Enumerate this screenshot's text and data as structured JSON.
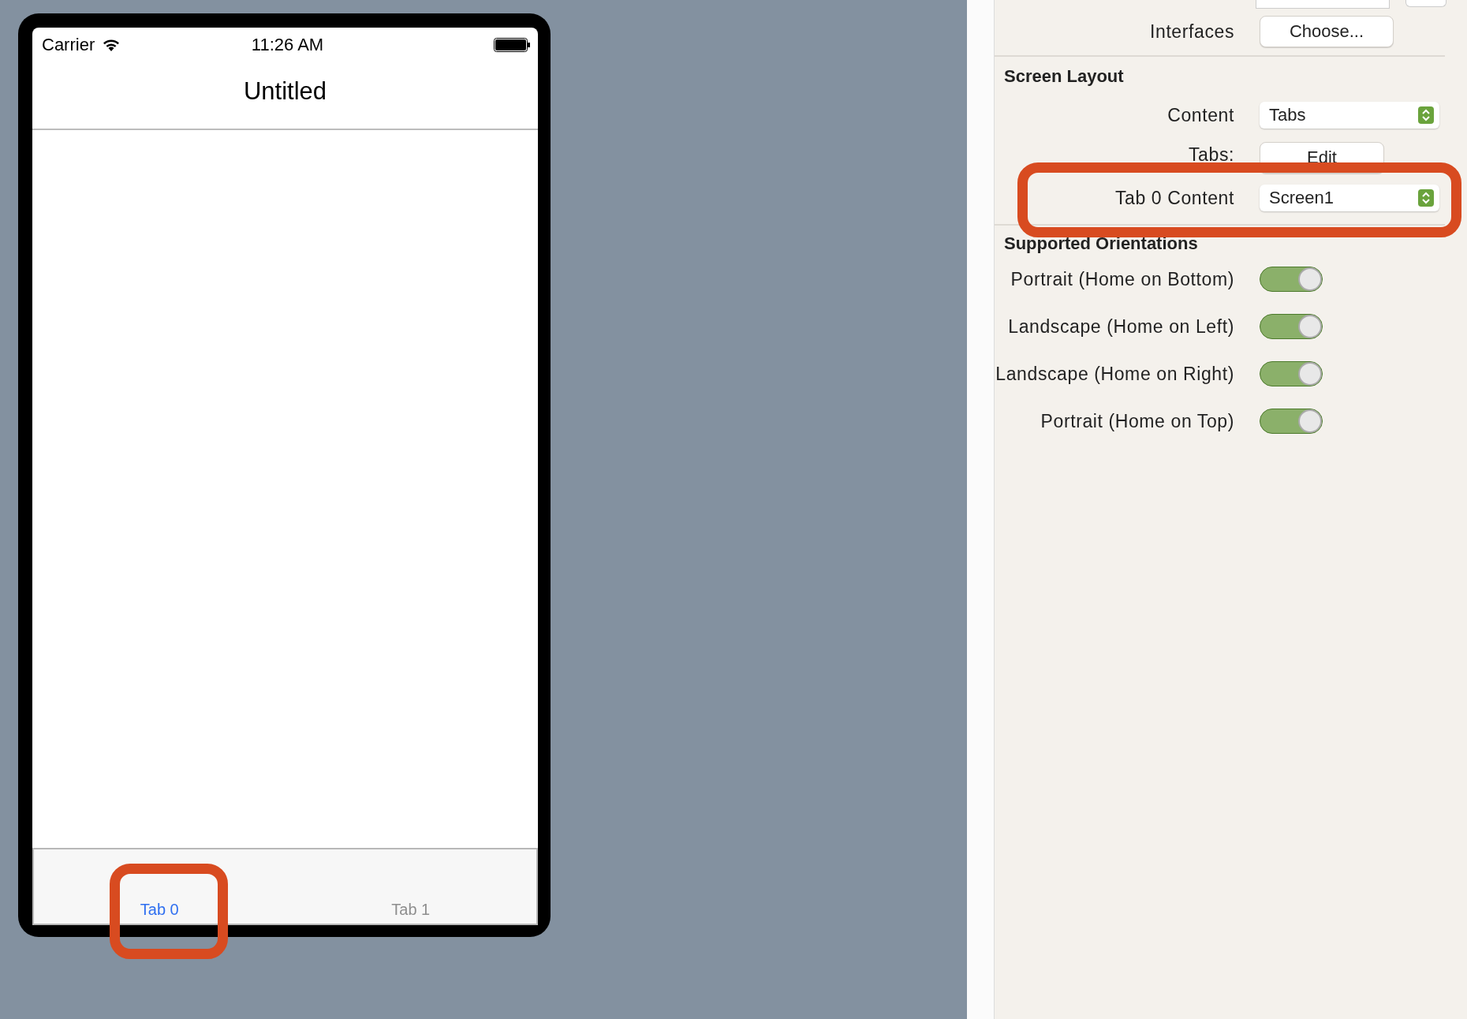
{
  "phone": {
    "status_bar": {
      "carrier": "Carrier",
      "time": "11:26 AM"
    },
    "nav_title": "Untitled",
    "tabs": [
      {
        "label": "Tab 0",
        "selected": true
      },
      {
        "label": "Tab 1",
        "selected": false
      }
    ]
  },
  "inspector": {
    "interfaces": {
      "label": "Interfaces",
      "button": "Choose..."
    },
    "screen_layout": {
      "heading": "Screen Layout",
      "content": {
        "label": "Content",
        "value": "Tabs"
      },
      "tabs": {
        "label": "Tabs:",
        "button": "Edit"
      },
      "tab_content": {
        "label": "Tab 0 Content",
        "value": "Screen1"
      }
    },
    "orientations": {
      "heading": "Supported Orientations",
      "items": [
        {
          "label": "Portrait (Home on Bottom)",
          "on": true
        },
        {
          "label": "Landscape (Home on Left)",
          "on": true
        },
        {
          "label": "Landscape (Home on Right)",
          "on": true
        },
        {
          "label": "Portrait (Home on Top)",
          "on": true
        }
      ]
    }
  }
}
